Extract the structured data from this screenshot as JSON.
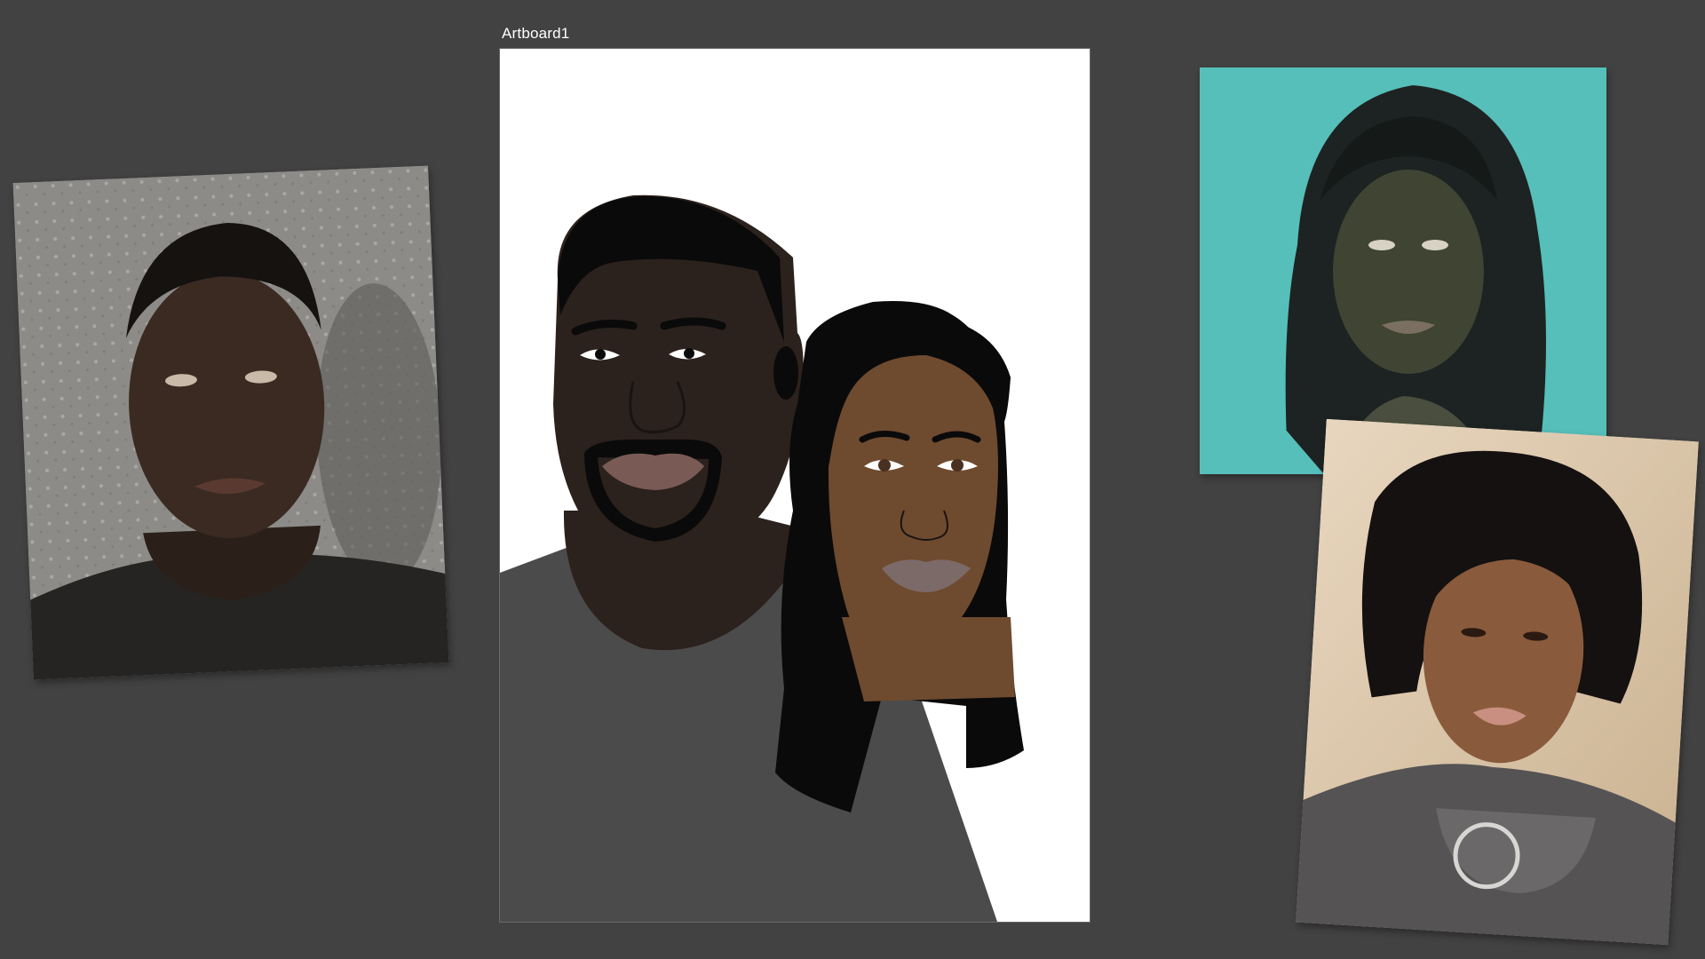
{
  "artboard": {
    "name": "Artboard1"
  },
  "colors": {
    "workspace_background": "#424242",
    "artboard_background": "#ffffff",
    "portrait_background": "#56bfba",
    "shirt_gray": "#4b4b4b",
    "skin_dark": "#2b211d",
    "skin_brown": "#6e4a2f",
    "hair_black": "#0a0a0a"
  },
  "references": [
    {
      "subject": "man-photo"
    },
    {
      "subject": "painted-portrait"
    },
    {
      "subject": "woman-selfie"
    }
  ]
}
